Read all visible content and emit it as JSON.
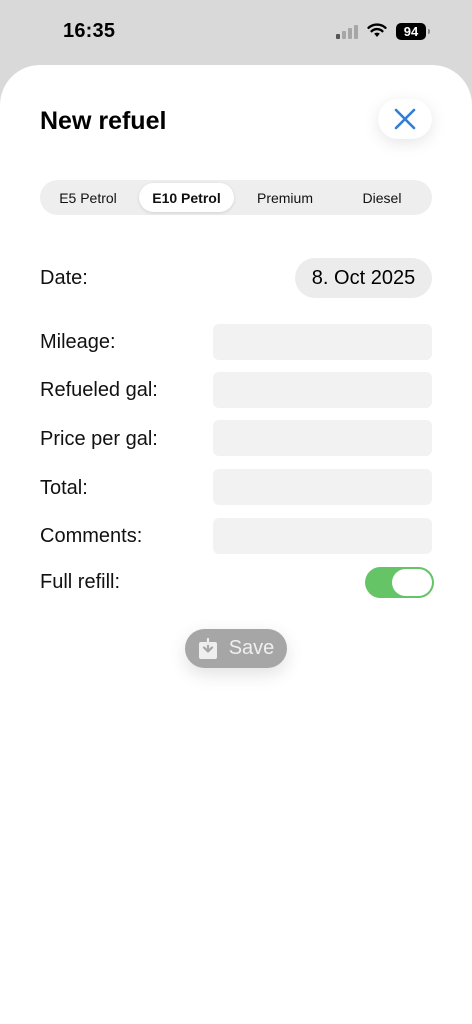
{
  "status_bar": {
    "time": "16:35",
    "battery": "94"
  },
  "header": {
    "title": "New refuel",
    "close_icon": "close-icon"
  },
  "fuel_types": {
    "options": [
      "E5 Petrol",
      "E10 Petrol",
      "Premium",
      "Diesel"
    ],
    "selected": "E10 Petrol"
  },
  "form": {
    "date_label": "Date:",
    "date_value": "8. Oct 2025",
    "mileage_label": "Mileage:",
    "mileage_value": "",
    "refueled_label": "Refueled gal:",
    "refueled_value": "",
    "price_label": "Price per gal:",
    "price_value": "",
    "total_label": "Total:",
    "total_value": "",
    "comments_label": "Comments:",
    "comments_value": "",
    "full_refill_label": "Full refill:",
    "full_refill_on": true
  },
  "actions": {
    "save_label": "Save",
    "save_icon": "download-tray-icon"
  },
  "colors": {
    "accent": "#2f7ed8",
    "toggle_on": "#65c466",
    "save_disabled": "#a6a6a6"
  }
}
